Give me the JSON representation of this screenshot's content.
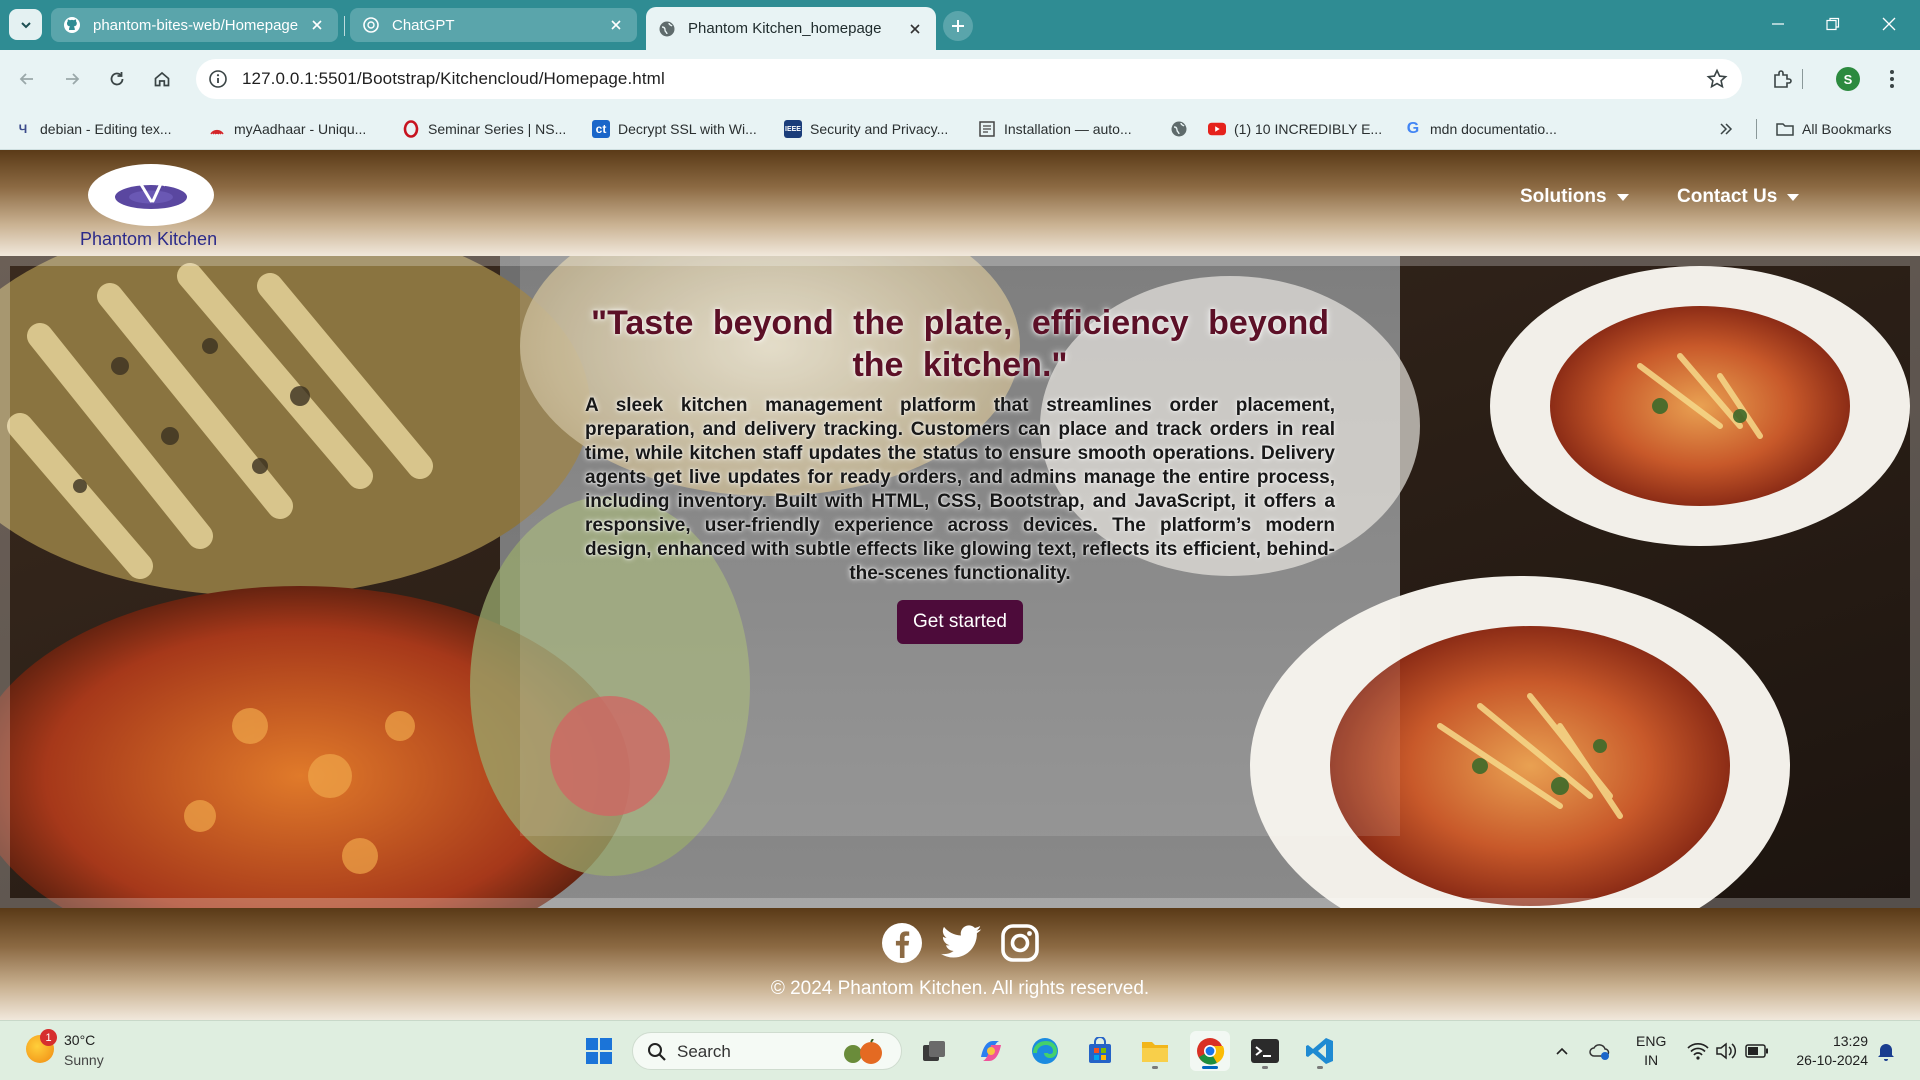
{
  "browser": {
    "tabs": [
      {
        "title": "phantom-bites-web/Homepage",
        "icon": "github-icon"
      },
      {
        "title": "ChatGPT",
        "icon": "chatgpt-icon"
      },
      {
        "title": "Phantom Kitchen_homepage",
        "icon": "globe-icon",
        "active": true
      }
    ],
    "url": "127.0.0.1:5501/Bootstrap/Kitchencloud/Homepage.html",
    "profile_initial": "S",
    "bookmarks": [
      {
        "label": "debian - Editing tex...",
        "icon": "overleaf-icon"
      },
      {
        "label": "myAadhaar - Uniqu...",
        "icon": "aadhaar-icon"
      },
      {
        "label": "Seminar Series | NS...",
        "icon": "opera-icon"
      },
      {
        "label": "Decrypt SSL with Wi...",
        "icon": "ct-icon"
      },
      {
        "label": "Security and Privacy...",
        "icon": "ieee-icon"
      },
      {
        "label": "Installation — auto...",
        "icon": "docs-icon"
      },
      {
        "label": "",
        "icon": "globe-icon"
      },
      {
        "label": "(1) 10 INCREDIBLY E...",
        "icon": "youtube-icon"
      },
      {
        "label": "mdn documentatio...",
        "icon": "google-icon"
      }
    ],
    "all_bookmarks": "All Bookmarks"
  },
  "site": {
    "brand": "Phantom Kitchen",
    "nav": [
      "Solutions",
      "Contact Us"
    ],
    "hero": {
      "tagline": "\"Taste beyond the plate, efficiency beyond the kitchen.\"",
      "description": "A sleek kitchen management platform that streamlines order placement, preparation, and delivery tracking. Customers can place and track orders in real time, while kitchen staff updates the status to ensure smooth operations. Delivery agents get live updates for ready orders, and admins manage the entire process, including inventory. Built with HTML, CSS, Bootstrap, and JavaScript, it offers a responsive, user-friendly experience across devices. The platform’s modern design, enhanced with subtle effects like glowing text, reflects its efficient, behind-the-scenes functionality.",
      "cta": "Get started"
    },
    "footer": {
      "social": [
        "facebook-icon",
        "twitter-icon",
        "instagram-icon"
      ],
      "copyright": "© 2024 Phantom Kitchen. All rights reserved."
    }
  },
  "taskbar": {
    "weather": {
      "temp": "30°C",
      "condition": "Sunny",
      "badge": "1"
    },
    "search_placeholder": "Search",
    "lang": {
      "line1": "ENG",
      "line2": "IN"
    },
    "time": "13:29",
    "date": "26-10-2024"
  },
  "colors": {
    "tabstrip": "#2f8c93",
    "toolbar": "#e8f3f4",
    "accent_button": "#4d0b3a",
    "tagline": "#5c1027",
    "brand_text": "#2b2a8a"
  }
}
